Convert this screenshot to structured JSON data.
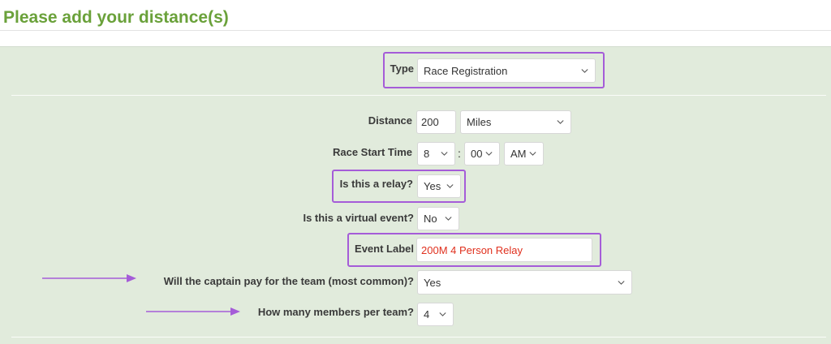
{
  "header": {
    "title": "Please add your distance(s)"
  },
  "form": {
    "type": {
      "label": "Type",
      "value": "Race Registration"
    },
    "distance": {
      "label": "Distance",
      "value": "200",
      "unit": "Miles"
    },
    "race_start_time": {
      "label": "Race Start Time",
      "hour": "8",
      "separator": ":",
      "minute": "00",
      "ampm": "AM"
    },
    "relay": {
      "label": "Is this a relay?",
      "value": "Yes"
    },
    "virtual": {
      "label": "Is this a virtual event?",
      "value": "No"
    },
    "event_label": {
      "label": "Event Label",
      "value": "200M 4 Person Relay"
    },
    "captain_pay": {
      "label": "Will the captain pay for the team (most common)?",
      "value": "Yes"
    },
    "members": {
      "label": "How many members per team?",
      "value": "4"
    }
  },
  "colors": {
    "title_green": "#6aa13a",
    "panel_bg": "#e1ebdc",
    "highlight_purple": "#a55cd8",
    "event_label_text": "#e0301e"
  },
  "icons": {
    "dropdown": "chevron-down-icon",
    "annotation": "arrow-right-icon"
  }
}
